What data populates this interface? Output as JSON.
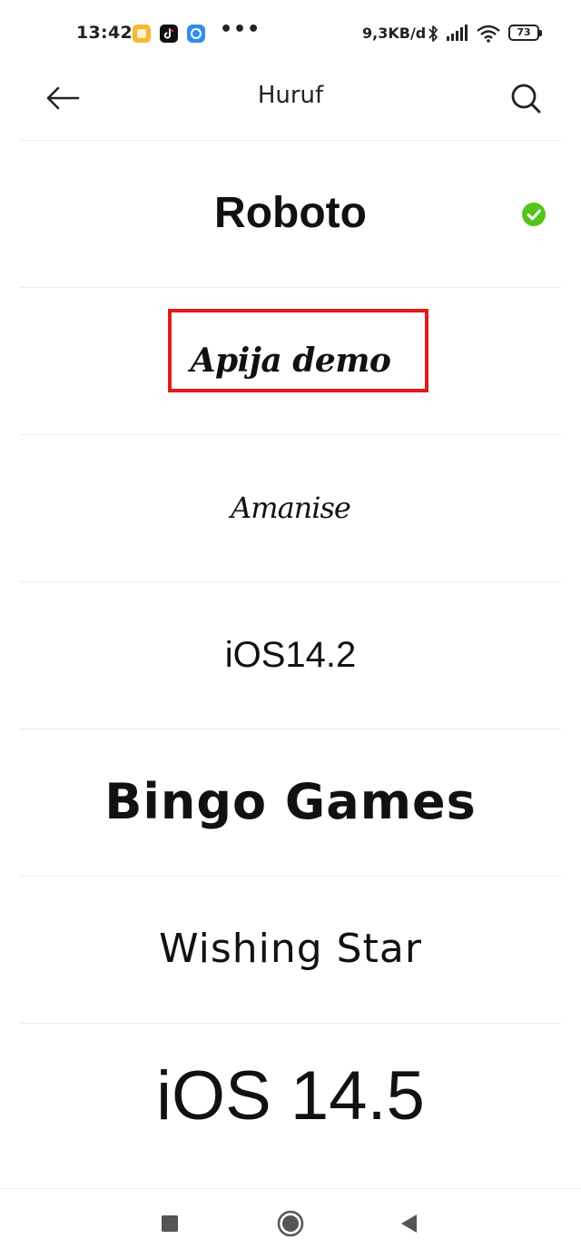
{
  "status_bar": {
    "time": "13:42",
    "app_icons": [
      "files-icon",
      "tiktok-icon",
      "sync-icon"
    ],
    "more_indicator": "•••",
    "network_speed": "9,3KB/d",
    "battery_level": "73",
    "system_icons": [
      "bluetooth-icon",
      "signal-icon",
      "wifi-icon",
      "battery-icon"
    ]
  },
  "header": {
    "title": "Huruf",
    "back_icon": "arrow-left-icon",
    "search_icon": "search-icon"
  },
  "fonts": [
    {
      "name": "Roboto",
      "selected": true
    },
    {
      "name": "Apija demo",
      "selected": false,
      "highlighted": true
    },
    {
      "name": "Amanise",
      "selected": false
    },
    {
      "name": "iOS14.2",
      "selected": false
    },
    {
      "name": "Bingo Games",
      "selected": false
    },
    {
      "name": "Wishing Star",
      "selected": false
    },
    {
      "name": "iOS 14.5",
      "selected": false
    }
  ],
  "colors": {
    "selected_check": "#52c41a",
    "highlight_border": "#e01b1b"
  },
  "nav_bar": {
    "icons": [
      "recent-apps-icon",
      "home-icon",
      "back-triangle-icon"
    ]
  }
}
